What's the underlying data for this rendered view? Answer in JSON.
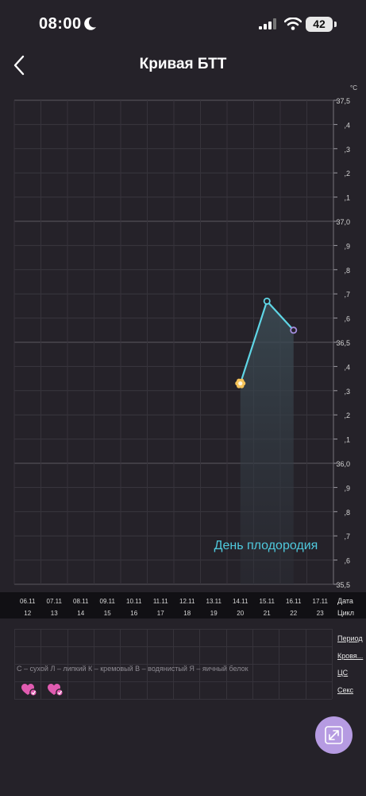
{
  "status_bar": {
    "time": "08:00",
    "battery": "42"
  },
  "header": {
    "title": "Кривая БТТ"
  },
  "chart_data": {
    "type": "line",
    "unit": "°C",
    "ylim": [
      35.5,
      37.5
    ],
    "y_ticks": [
      "37,5",
      ",4",
      ",3",
      ",2",
      ",1",
      "37,0",
      ",9",
      ",8",
      ",7",
      ",6",
      "36,5",
      ",4",
      ",3",
      ",2",
      ",1",
      "36,0",
      ",9",
      ",8",
      ",7",
      ",6",
      "35,5"
    ],
    "major_ticks": [
      37.5,
      37.0,
      36.5,
      36.0,
      35.5
    ],
    "categories": [
      "06.11",
      "07.11",
      "08.11",
      "09.11",
      "10.11",
      "11.11",
      "12.11",
      "13.11",
      "14.11",
      "15.11",
      "16.11",
      "17.11"
    ],
    "cycle_days": [
      "12",
      "13",
      "14",
      "15",
      "16",
      "17",
      "18",
      "19",
      "20",
      "21",
      "22",
      "23"
    ],
    "series": [
      {
        "values": [
          null,
          null,
          null,
          null,
          null,
          null,
          null,
          null,
          36.33,
          36.67,
          36.55,
          null
        ]
      }
    ],
    "fertile_window": {
      "start_index": 8,
      "end_index": 10,
      "label": "День плодородия"
    },
    "ovulation_marker_index": 8,
    "colors": {
      "line": "#5fd6e6",
      "last_point": "#a58ee0",
      "marker": "#f5c35a",
      "fertile_text": "#4fc9dd"
    }
  },
  "table": {
    "row_labels": {
      "date": "Дата",
      "cycle": "Цикл"
    },
    "side_labels": [
      "Период",
      "Кровя...",
      "ЦС",
      "Секс"
    ],
    "mucus_legend": "С – сухой Л – липкий К – кремовый В – водянистый Я – яичный белок",
    "sex_icon_indices": [
      0,
      1
    ],
    "colors": {
      "sex_icon": "#e05bb0"
    }
  },
  "fab": {
    "icon": "expand-icon",
    "color": "#b69be2"
  }
}
